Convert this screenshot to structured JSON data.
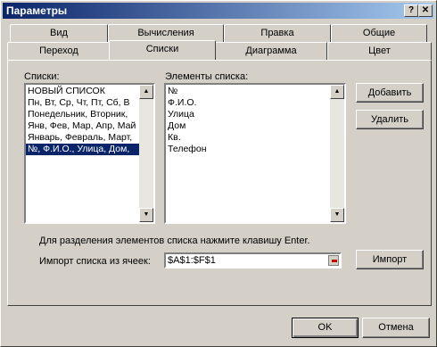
{
  "window": {
    "title": "Параметры",
    "help_label": "?",
    "close_label": "✕"
  },
  "tabs": {
    "row1": [
      "Вид",
      "Вычисления",
      "Правка",
      "Общие"
    ],
    "row2": [
      "Переход",
      "Списки",
      "Диаграмма",
      "Цвет"
    ],
    "active": "Списки"
  },
  "lists": {
    "label": "Списки:",
    "items": [
      "НОВЫЙ СПИСОК",
      "Пн, Вт, Ср, Чт, Пт, Сб, В",
      "Понедельник, Вторник, ",
      "Янв, Фев, Мар, Апр, Май",
      "Январь, Февраль, Март, ",
      "№, Ф.И.О., Улица, Дом, "
    ],
    "selected_index": 5
  },
  "entries": {
    "label": "Элементы списка:",
    "items": [
      "№",
      "Ф.И.О.",
      "Улица",
      "Дом",
      "Кв.",
      "Телефон"
    ]
  },
  "buttons": {
    "add": "Добавить",
    "delete": "Удалить",
    "import": "Импорт",
    "ok": "OK",
    "cancel": "Отмена"
  },
  "hint": "Для разделения элементов списка нажмите клавишу Enter.",
  "import_field": {
    "label": "Импорт списка из ячеек:",
    "value": "$A$1:$F$1"
  }
}
